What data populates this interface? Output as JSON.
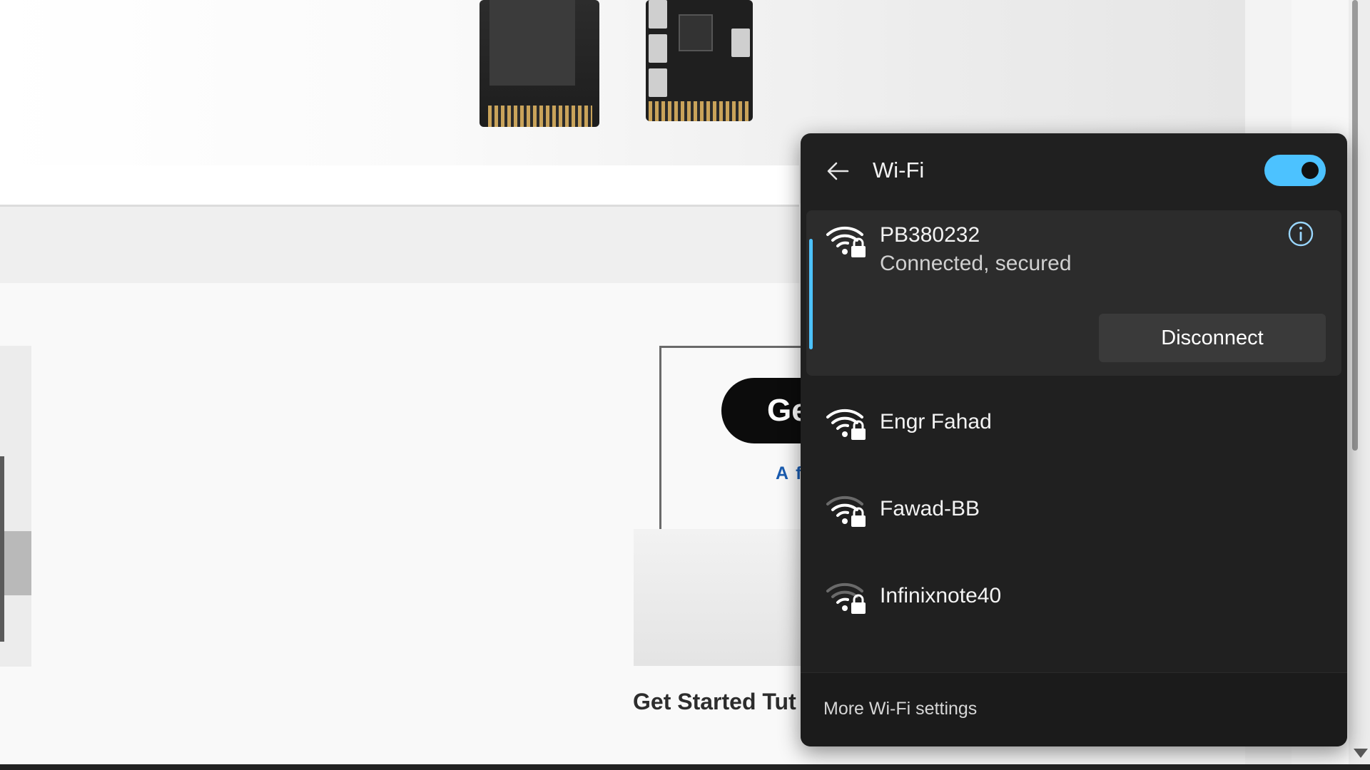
{
  "background_page": {
    "cta_button_text": "Ge",
    "cta_link_text": "A f",
    "tutorial_title": "Get Started Tut"
  },
  "wifi_flyout": {
    "title": "Wi-Fi",
    "toggle_state": "on",
    "accent_color": "#4cc2ff",
    "connected_network": {
      "name": "PB380232",
      "status": "Connected, secured",
      "icon": "wifi-secured-icon",
      "disconnect_label": "Disconnect"
    },
    "networks": [
      {
        "name": "Engr Fahad",
        "icon": "wifi-secured-icon"
      },
      {
        "name": "Fawad-BB",
        "icon": "wifi-secured-icon"
      },
      {
        "name": "Infinixnote40",
        "icon": "wifi-secured-icon"
      }
    ],
    "footer_link": "More Wi-Fi settings"
  }
}
